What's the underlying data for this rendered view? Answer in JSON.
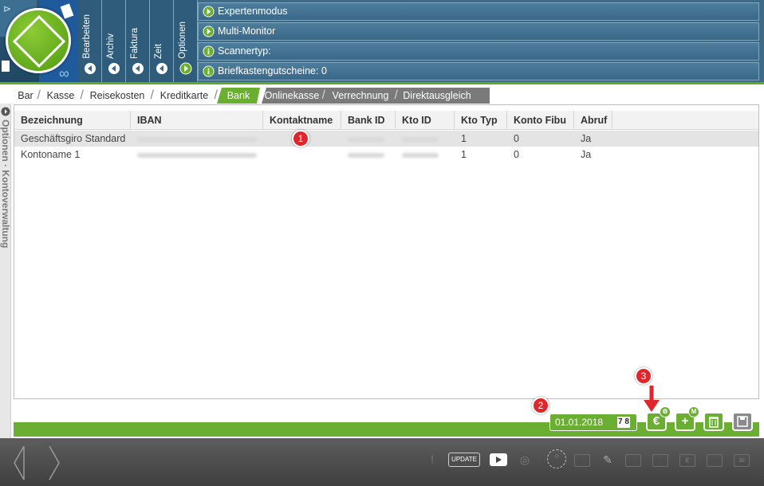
{
  "header": {
    "vertical_tabs": [
      {
        "label": "Bearbeiten"
      },
      {
        "label": "Archiv"
      },
      {
        "label": "Faktura"
      },
      {
        "label": "Zeit"
      },
      {
        "label": "Optionen"
      }
    ],
    "options": [
      {
        "label": "Expertenmodus",
        "icon": "arrow-right-icon"
      },
      {
        "label": "Multi-Monitor",
        "icon": "arrow-right-icon"
      },
      {
        "label": "Scannertyp:",
        "icon": "info-icon"
      },
      {
        "label": "Briefkastengutscheine: 0",
        "icon": "info-icon"
      }
    ]
  },
  "sidebar": {
    "label": "Optionen · Kontoverwaltung"
  },
  "tabs": [
    {
      "label": "Bar"
    },
    {
      "label": "Kasse"
    },
    {
      "label": "Reisekosten"
    },
    {
      "label": "Kreditkarte"
    },
    {
      "label": "Bank"
    },
    {
      "label": "Onlinekasse"
    },
    {
      "label": "Verrechnung"
    },
    {
      "label": "Direktausgleich"
    }
  ],
  "active_tab": "Bank",
  "table": {
    "columns": [
      "Bezeichnung",
      "IBAN",
      "Kontaktname",
      "Bank ID",
      "Kto ID",
      "Kto Typ",
      "Konto Fibu",
      "Abruf"
    ],
    "rows": [
      {
        "bezeichnung": "Geschäftsgiro Standard",
        "kto_typ": "1",
        "konto_fibu": "0",
        "abruf": "Ja"
      },
      {
        "bezeichnung": "Kontoname 1",
        "kto_typ": "1",
        "konto_fibu": "0",
        "abruf": "Ja"
      }
    ]
  },
  "footer": {
    "date": "01.01.2018",
    "calendar_label": "7 8",
    "euro_button": "€",
    "euro_badge": "⚙",
    "add_button": "+",
    "add_badge": "M"
  },
  "markers": [
    "1",
    "2",
    "3"
  ],
  "bottombar": {
    "update_label": "UPDATE"
  },
  "colors": {
    "header_blue": "#3e6a86",
    "accent_green": "#6aaf32",
    "marker_red": "#e0262b"
  }
}
